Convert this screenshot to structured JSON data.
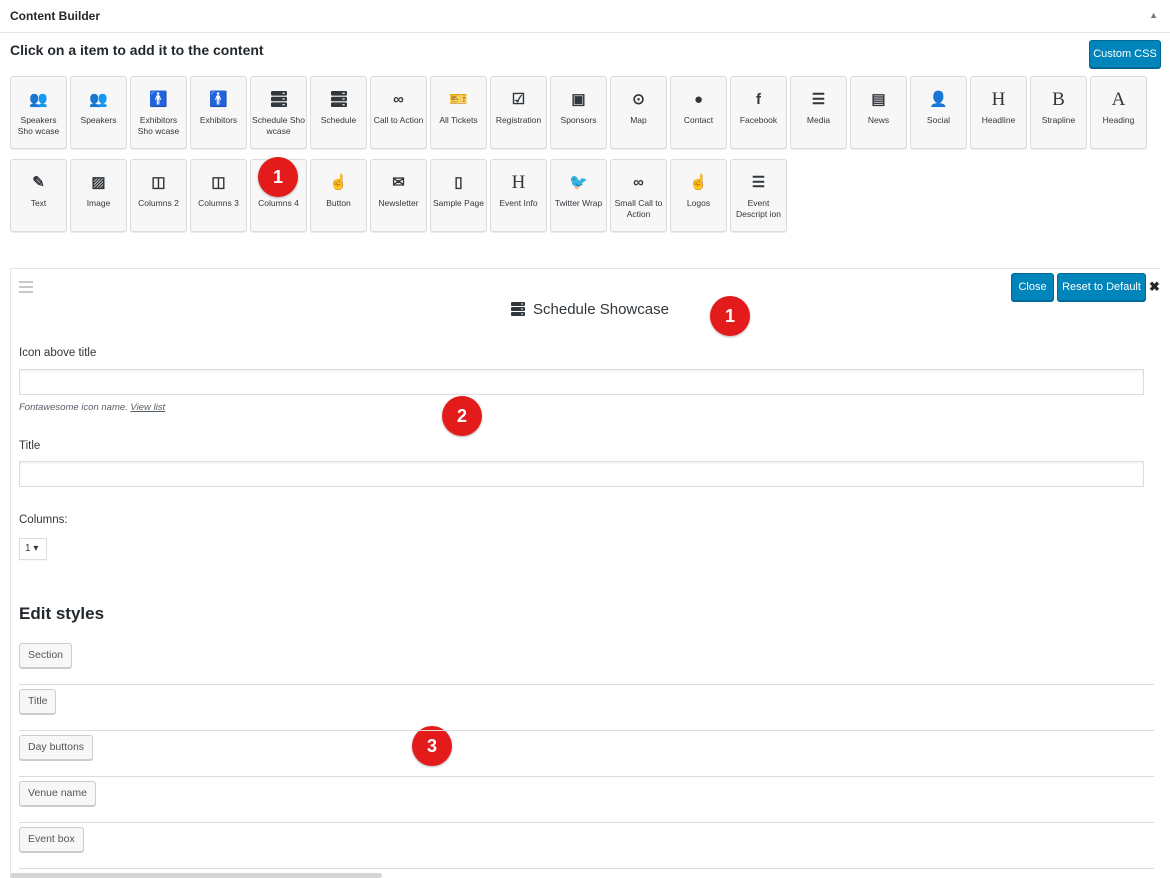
{
  "header": {
    "title": "Content Builder",
    "collapse_icon": "triangle-up-icon"
  },
  "instruction": "Click on a item to add it to the content",
  "custom_css_label": "Custom CSS",
  "tiles_row1": [
    {
      "label": "Speakers Sho wcase",
      "icon": "users"
    },
    {
      "label": "Speakers",
      "icon": "users"
    },
    {
      "label": "Exhibitors Sho wcase",
      "icon": "male"
    },
    {
      "label": "Exhibitors",
      "icon": "male"
    },
    {
      "label": "Schedule Sho wcase",
      "icon": "server"
    },
    {
      "label": "Schedule",
      "icon": "server"
    },
    {
      "label": "Call to Action",
      "icon": "gamepad"
    },
    {
      "label": "All Tickets",
      "icon": "ticket"
    },
    {
      "label": "Registration",
      "icon": "check"
    },
    {
      "label": "Sponsors",
      "icon": "money"
    },
    {
      "label": "Map",
      "icon": "target"
    },
    {
      "label": "Contact",
      "icon": "comment"
    },
    {
      "label": "Facebook",
      "icon": "facebook"
    },
    {
      "label": "Media",
      "icon": "list"
    },
    {
      "label": "News",
      "icon": "newspaper"
    },
    {
      "label": "Social",
      "icon": "user-plus"
    },
    {
      "label": "Headline",
      "icon": "letter-H"
    },
    {
      "label": "Strapline",
      "icon": "letter-B"
    },
    {
      "label": "Heading",
      "icon": "letter-A"
    }
  ],
  "tiles_row2": [
    {
      "label": "Text",
      "icon": "pencil"
    },
    {
      "label": "Image",
      "icon": "image"
    },
    {
      "label": "Columns 2",
      "icon": "columns"
    },
    {
      "label": "Columns 3",
      "icon": "columns"
    },
    {
      "label": "Columns 4",
      "icon": "columns"
    },
    {
      "label": "Button",
      "icon": "hand"
    },
    {
      "label": "Newsletter",
      "icon": "envelope"
    },
    {
      "label": "Sample Page",
      "icon": "file"
    },
    {
      "label": "Event Info",
      "icon": "letter-H"
    },
    {
      "label": "Twitter Wrap",
      "icon": "twitter"
    },
    {
      "label": "Small Call to Action",
      "icon": "gamepad"
    },
    {
      "label": "Logos",
      "icon": "hand"
    },
    {
      "label": "Event Descript ion",
      "icon": "list"
    }
  ],
  "glyphs": {
    "users": "👥",
    "male": "🚹",
    "gamepad": "∞",
    "ticket": "🎫",
    "check": "☑",
    "money": "▣",
    "target": "⊙",
    "comment": "●",
    "facebook": "f",
    "newspaper": "▤",
    "user-plus": "👤",
    "letter-H": "H",
    "letter-B": "B",
    "letter-A": "A",
    "pencil": "✎",
    "image": "▨",
    "columns": "◫",
    "hand": "☝",
    "envelope": "✉",
    "file": "▯",
    "twitter": "🐦",
    "list": "☰",
    "server": "≡"
  },
  "badges": [
    "1",
    "1",
    "2",
    "3"
  ],
  "panel": {
    "title": "Schedule Showcase",
    "close_label": "Close",
    "reset_label": "Reset to Default",
    "remove_icon": "close-icon",
    "icon_label": "Icon above title",
    "icon_value": "",
    "hint_text": "Fontawesome icon name.",
    "hint_link": "View list",
    "title_label": "Title",
    "title_value": "",
    "columns_label": "Columns:",
    "columns_value": "1 ▾",
    "styles_heading": "Edit styles",
    "styles": [
      "Section",
      "Title",
      "Day buttons",
      "Venue name",
      "Event box"
    ]
  }
}
